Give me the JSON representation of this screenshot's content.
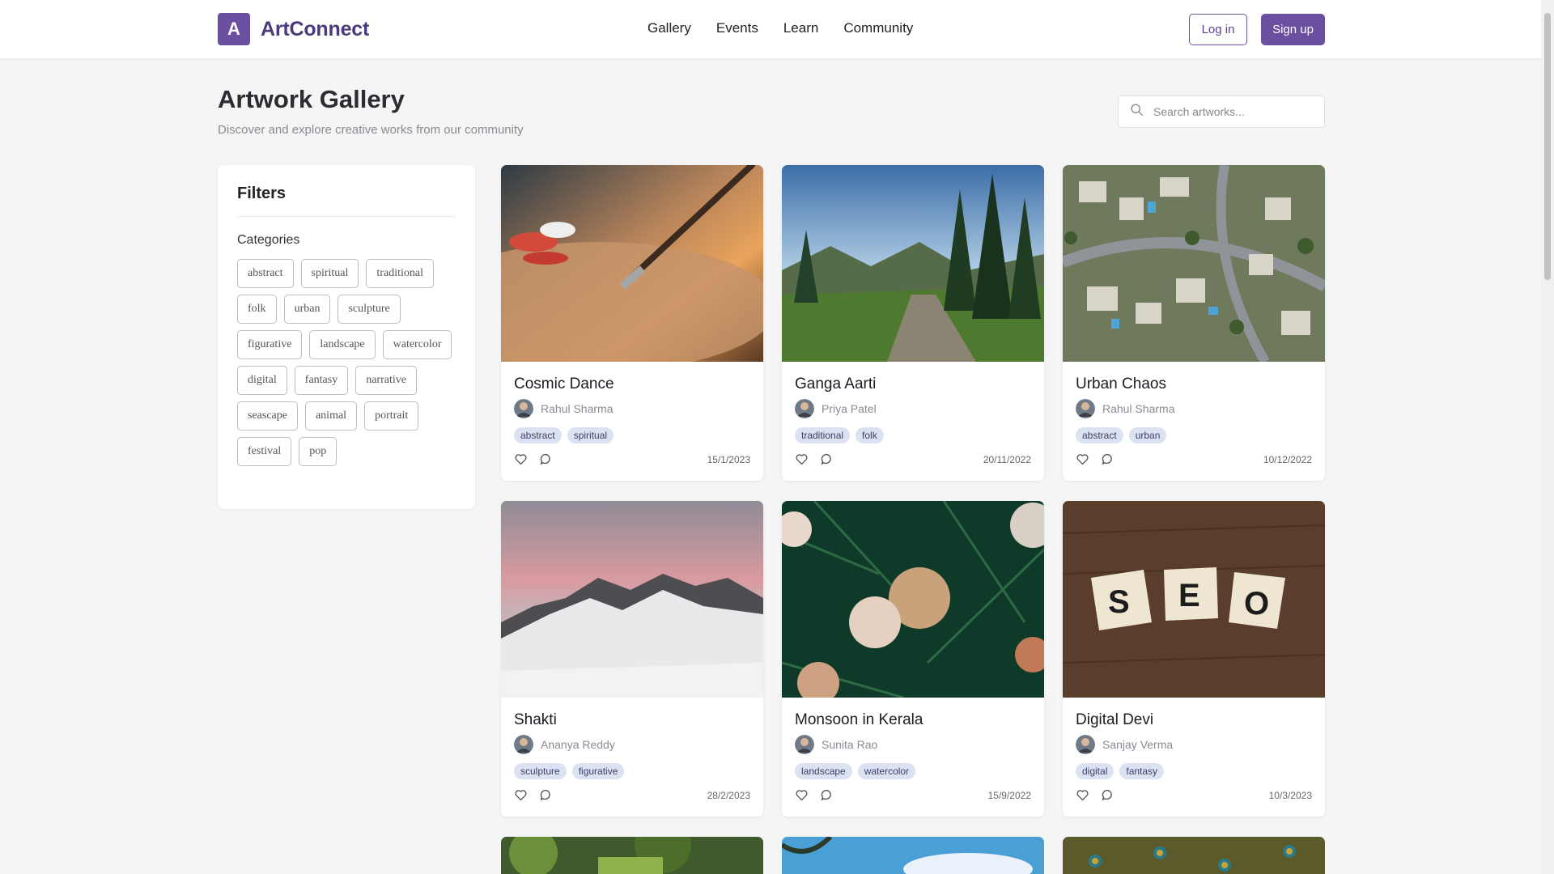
{
  "brand": {
    "logo_letter": "A",
    "name": "ArtConnect",
    "accent": "#6b4fa0"
  },
  "nav": [
    "Gallery",
    "Events",
    "Learn",
    "Community"
  ],
  "auth": {
    "login": "Log in",
    "signup": "Sign up"
  },
  "page": {
    "title": "Artwork Gallery",
    "subtitle": "Discover and explore creative works from our community"
  },
  "search": {
    "placeholder": "Search artworks...",
    "icon": "search-icon"
  },
  "filters": {
    "title": "Filters",
    "categories_label": "Categories",
    "categories": [
      "abstract",
      "spiritual",
      "traditional",
      "folk",
      "urban",
      "sculpture",
      "figurative",
      "landscape",
      "watercolor",
      "digital",
      "fantasy",
      "narrative",
      "seascape",
      "animal",
      "portrait",
      "festival",
      "pop"
    ]
  },
  "artworks": [
    {
      "title": "Cosmic Dance",
      "artist": "Rahul Sharma",
      "tags": [
        "abstract",
        "spiritual"
      ],
      "date": "15/1/2023",
      "image": "paint-palette-brush"
    },
    {
      "title": "Ganga Aarti",
      "artist": "Priya Patel",
      "tags": [
        "traditional",
        "folk"
      ],
      "date": "20/11/2022",
      "image": "forest-path-mountains"
    },
    {
      "title": "Urban Chaos",
      "artist": "Rahul Sharma",
      "tags": [
        "abstract",
        "urban"
      ],
      "date": "10/12/2022",
      "image": "aerial-city"
    },
    {
      "title": "Shakti",
      "artist": "Ananya Reddy",
      "tags": [
        "sculpture",
        "figurative"
      ],
      "date": "28/2/2023",
      "image": "snowy-mountains"
    },
    {
      "title": "Monsoon in Kerala",
      "artist": "Sunita Rao",
      "tags": [
        "landscape",
        "watercolor"
      ],
      "date": "15/9/2022",
      "image": "christmas-ornaments"
    },
    {
      "title": "Digital Devi",
      "artist": "Sanjay Verma",
      "tags": [
        "digital",
        "fantasy"
      ],
      "date": "10/3/2023",
      "image": "seo-tiles"
    }
  ],
  "partial_images": [
    "jungle",
    "sky-palms",
    "peacock-feathers"
  ]
}
